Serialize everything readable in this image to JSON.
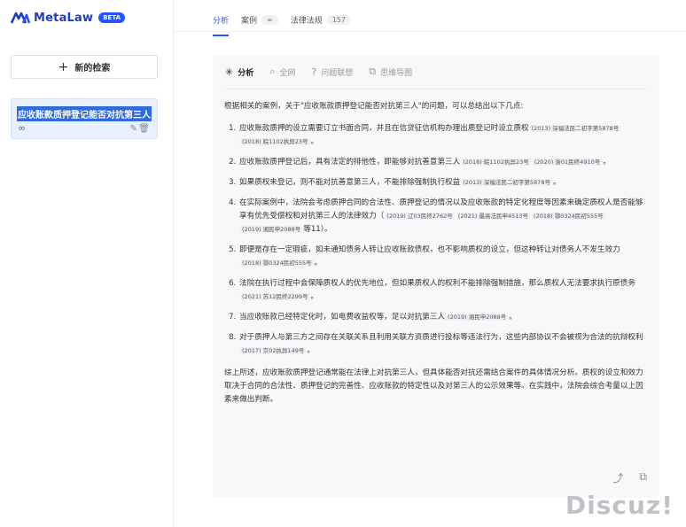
{
  "brand": {
    "name": "MetaLaw",
    "badge": "BETA",
    "color": "#2453ff"
  },
  "sidebar": {
    "new_search": {
      "icon": "+",
      "label": "新的检索"
    },
    "history": [
      {
        "title": "应收账款质押登记能否对抗第三人",
        "meta": "∞",
        "edit_icon": "✎",
        "delete_icon": "🗑"
      }
    ]
  },
  "topnav": {
    "tabs": [
      {
        "label": "分析",
        "active": true
      },
      {
        "label": "案例",
        "count": "∞"
      },
      {
        "label": "法律法规",
        "count": "157"
      }
    ]
  },
  "subtabs": [
    {
      "icon": "✳",
      "label": "分析",
      "active": true
    },
    {
      "icon": "⌕",
      "label": "全网"
    },
    {
      "icon": "?",
      "label": "问题联想"
    },
    {
      "icon": "⧉",
      "label": "思维导图"
    }
  ],
  "content": {
    "intro": "根据相关的案例，关于\"应收账款质押登记能否对抗第三人\"的问题，可以总结出以下几点:",
    "points": [
      {
        "text": "应收账款质押的设立需要订立书面合同，并且在信贷征信机构办理出质登记时设立质权",
        "cites": [
          "(2013) 深福法民二初字第5878号",
          "(2018) 皖1102执异23号"
        ],
        "tail": "。"
      },
      {
        "text": "应收账款质押登记后，具有法定的排他性，即能够对抗善意第三人",
        "cites": [
          "(2018) 皖1102执异23号",
          "(2020) 浙01民终4910号"
        ],
        "tail": "。"
      },
      {
        "text": "如果质权未登记，则不能对抗善意第三人，不能排除强制执行权益",
        "cites": [
          "(2013) 深福法民二初字第5878号"
        ],
        "tail": "。"
      },
      {
        "text": "在实际案例中，法院会考虑质押合同的合法性、质押登记的情况以及应收账款的特定化程度等因素来确定质权人是否能够享有优先受偿权和对抗第三人的法律效力（",
        "cites": [
          "(2019) 辽03民终2762号",
          "(2021) 最高法民申4513号",
          "(2018) 鄂0324民初555号",
          "(2019) 湘民申2088号"
        ],
        "tail": "等11）。"
      },
      {
        "text": "即便是存在一定瑕疵，如未通知债务人转让应收账款债权，也不影响质权的设立，但这种转让对债务人不发生效力",
        "cites": [
          "(2018) 鄂0324民初555号"
        ],
        "tail": "。"
      },
      {
        "text": "法院在执行过程中会保障质权人的优先地位，但如果质权人的权利不能排除强制措施，那么质权人无法要求执行原债务",
        "cites": [
          "(2021) 苏12民终2299号"
        ],
        "tail": "。"
      },
      {
        "text": "当应收账款已经特定化时，如电费收益权等，足以对抗第三人",
        "cites": [
          "(2019) 湘民申2088号"
        ],
        "tail": "。"
      },
      {
        "text": "对于质押人与第三方之间存在关联关系且利用关联方资质进行投标等违法行为，这些内部协议不会被视为合法的抗辩权利",
        "cites": [
          "(2017) 京02执异149号"
        ],
        "tail": "。"
      }
    ],
    "summary": "综上所述，应收账款质押登记通常能在法律上对抗第三人，但具体能否对抗还需结合案件的具体情况分析。质权的设立和效力取决于合同的合法性、质押登记的完善性、应收账款的特定性以及对第三人的公示效果等。在实践中，法院会综合考量以上因素来做出判断。"
  },
  "actions": {
    "share_icon": "⤴",
    "copy_icon": "⧉"
  },
  "watermark": "Discuz!"
}
